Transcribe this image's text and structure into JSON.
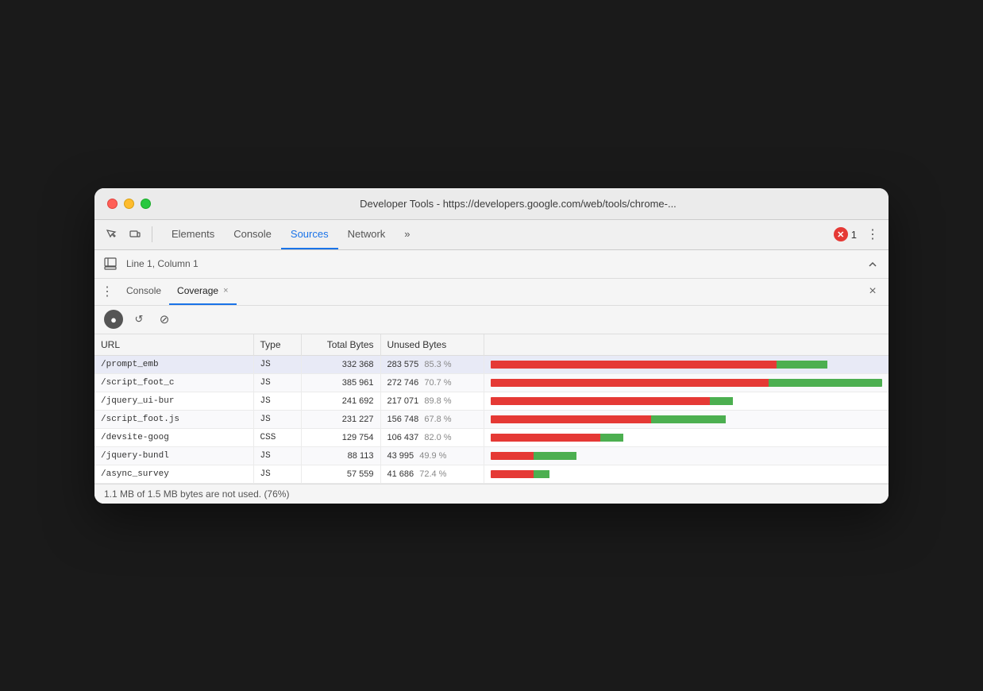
{
  "window": {
    "title": "Developer Tools - https://developers.google.com/web/tools/chrome-..."
  },
  "traffic_lights": {
    "red": "close",
    "yellow": "minimize",
    "green": "maximize"
  },
  "tabs": {
    "items": [
      {
        "label": "Elements",
        "active": false
      },
      {
        "label": "Console",
        "active": false
      },
      {
        "label": "Sources",
        "active": true
      },
      {
        "label": "Network",
        "active": false
      },
      {
        "label": "»",
        "active": false
      }
    ]
  },
  "error_badge": {
    "count": "1"
  },
  "secondary_toolbar": {
    "position": "Line 1, Column 1"
  },
  "panel_tabs": {
    "items": [
      {
        "label": "Console",
        "active": false,
        "closable": false
      },
      {
        "label": "Coverage",
        "active": true,
        "closable": true
      }
    ]
  },
  "coverage": {
    "toolbar": {
      "record_label": "Record",
      "reload_label": "Reload",
      "clear_label": "Clear"
    },
    "table": {
      "headers": [
        "URL",
        "Type",
        "Total Bytes",
        "Unused Bytes",
        ""
      ],
      "rows": [
        {
          "url": "/prompt_emb",
          "type": "JS",
          "total_bytes": "332 368",
          "unused_bytes": "283 575",
          "unused_pct": "85.3 %",
          "used_ratio": 0.147,
          "unused_ratio": 0.853,
          "highlighted": true
        },
        {
          "url": "/script_foot_c",
          "type": "JS",
          "total_bytes": "385 961",
          "unused_bytes": "272 746",
          "unused_pct": "70.7 %",
          "used_ratio": 0.293,
          "unused_ratio": 0.707,
          "highlighted": false
        },
        {
          "url": "/jquery_ui-bur",
          "type": "JS",
          "total_bytes": "241 692",
          "unused_bytes": "217 071",
          "unused_pct": "89.8 %",
          "used_ratio": 0.102,
          "unused_ratio": 0.898,
          "highlighted": false
        },
        {
          "url": "/script_foot.js",
          "type": "JS",
          "total_bytes": "231 227",
          "unused_bytes": "156 748",
          "unused_pct": "67.8 %",
          "used_ratio": 0.322,
          "unused_ratio": 0.678,
          "highlighted": false
        },
        {
          "url": "/devsite-goog",
          "type": "CSS",
          "total_bytes": "129 754",
          "unused_bytes": "106 437",
          "unused_pct": "82.0 %",
          "used_ratio": 0.18,
          "unused_ratio": 0.82,
          "highlighted": false
        },
        {
          "url": "/jquery-bundl",
          "type": "JS",
          "total_bytes": "88 113",
          "unused_bytes": "43 995",
          "unused_pct": "49.9 %",
          "used_ratio": 0.501,
          "unused_ratio": 0.499,
          "highlighted": false
        },
        {
          "url": "/async_survey",
          "type": "JS",
          "total_bytes": "57 559",
          "unused_bytes": "41 686",
          "unused_pct": "72.4 %",
          "used_ratio": 0.276,
          "unused_ratio": 0.724,
          "highlighted": false
        }
      ]
    },
    "status": "1.1 MB of 1.5 MB bytes are not used. (76%)"
  },
  "colors": {
    "bar_used": "#4caf50",
    "bar_unused": "#e53935",
    "active_tab_underline": "#1a73e8"
  }
}
